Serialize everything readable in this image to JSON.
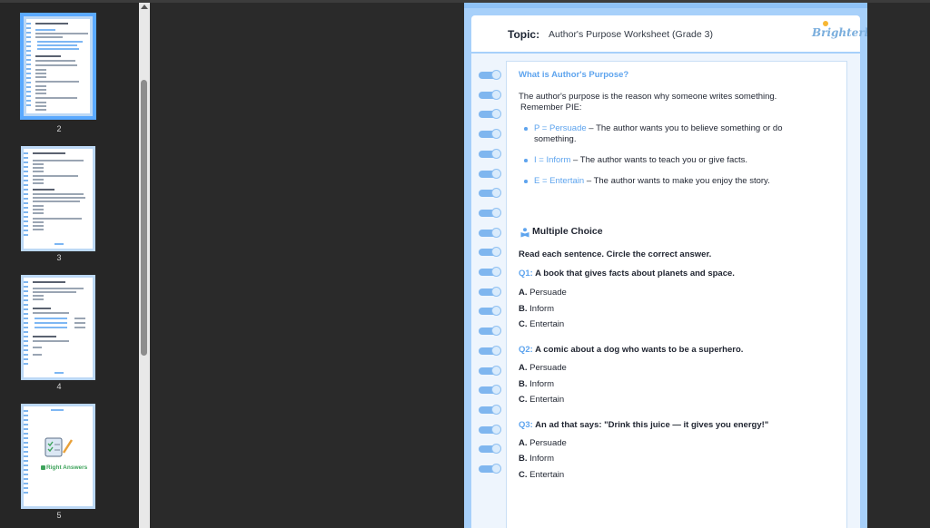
{
  "thumbnails": [
    {
      "number": "2",
      "active": true
    },
    {
      "number": "3",
      "active": false
    },
    {
      "number": "4",
      "active": false
    },
    {
      "number": "5",
      "active": false,
      "caption": "Right Answers"
    }
  ],
  "header": {
    "topic_label": "Topic:",
    "topic_text": "Author's Purpose Worksheet (Grade 3)",
    "logo": "Brighterly"
  },
  "intro": {
    "heading": "What is Author's Purpose?",
    "line1": "The author's purpose is the reason why someone writes something.",
    "line2": "Remember PIE:",
    "items": [
      {
        "key": "P = Persuade",
        "text": " – The author wants you to believe something or do",
        "text2": "something."
      },
      {
        "key": "I = Inform",
        "text": " – The author wants to teach you or give facts."
      },
      {
        "key": "E = Entertain",
        "text": " – The author wants to make you enjoy the story."
      }
    ]
  },
  "multiple_choice": {
    "title": "Multiple Choice",
    "instruction": "Read each sentence. Circle the correct answer.",
    "questions": [
      {
        "label": "Q1:",
        "text": "A book that gives facts about planets and space.",
        "options": [
          {
            "letter": "A.",
            "text": "Persuade"
          },
          {
            "letter": "B.",
            "text": "Inform"
          },
          {
            "letter": "C.",
            "text": "Entertain"
          }
        ]
      },
      {
        "label": "Q2:",
        "text": "A comic about a dog who wants to be a superhero.",
        "options": [
          {
            "letter": "A.",
            "text": "Persuade"
          },
          {
            "letter": "B.",
            "text": "Inform"
          },
          {
            "letter": "C.",
            "text": "Entertain"
          }
        ]
      },
      {
        "label": "Q3:",
        "text": "An ad that says: \"Drink this juice — it gives you energy!\"",
        "options": [
          {
            "letter": "A.",
            "text": "Persuade"
          },
          {
            "letter": "B.",
            "text": "Inform"
          },
          {
            "letter": "C.",
            "text": "Entertain"
          }
        ]
      }
    ]
  },
  "colors": {
    "accent": "#5ea4ee",
    "page_border": "#a7d0fa",
    "ring": "#7fb6ef"
  },
  "icons": {
    "mc_icon": "person-reading-icon",
    "scroll_up": "caret-up-icon",
    "check_icon": "checklist-icon"
  }
}
